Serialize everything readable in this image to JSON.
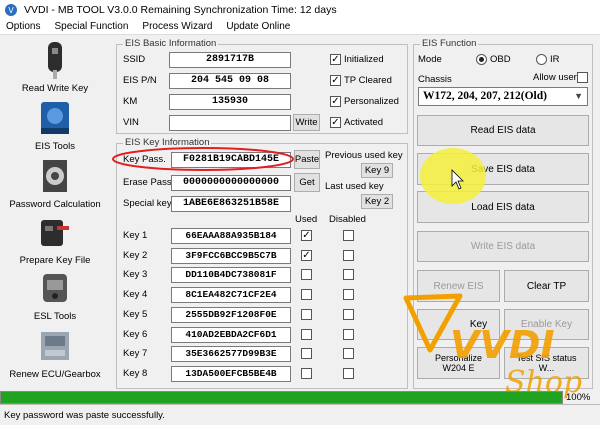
{
  "window": {
    "title": "VVDI - MB TOOL V3.0.0   Remaining Synchronization Time: 12 days"
  },
  "menu": [
    "Options",
    "Special Function",
    "Process Wizard",
    "Update Online"
  ],
  "sidebar": [
    {
      "label": "Read Write Key",
      "icon": "car-key-icon"
    },
    {
      "label": "EIS Tools",
      "icon": "eis-module-icon"
    },
    {
      "label": "Password Calculation",
      "icon": "gear-calculation-icon"
    },
    {
      "label": "Prepare Key File",
      "icon": "key-file-icon"
    },
    {
      "label": "ESL Tools",
      "icon": "esl-lock-icon"
    },
    {
      "label": "Renew ECU/Gearbox",
      "icon": "ecu-module-icon"
    }
  ],
  "eis_basic": {
    "title": "EIS Basic Information",
    "ssid_label": "SSID",
    "ssid": "2891717B",
    "pn_label": "EIS P/N",
    "pn": "204 545 09 08",
    "km_label": "KM",
    "km": "135930",
    "vin_label": "VIN",
    "vin": "",
    "write_label": "Write",
    "flags": [
      {
        "label": "Initialized",
        "checked": true
      },
      {
        "label": "TP Cleared",
        "checked": true
      },
      {
        "label": "Personalized",
        "checked": true
      },
      {
        "label": "Activated",
        "checked": true
      }
    ]
  },
  "eis_key": {
    "title": "EIS Key Information",
    "keypass_label": "Key Pass.",
    "keypass": "F0281B19CABD145E",
    "paste_label": "Paste",
    "erase_label": "Erase Pass.",
    "erase": "0000000000000000",
    "get_label": "Get",
    "special_label": "Special key",
    "special": "1ABE6E863251B58E",
    "prev_used_label": "Previous used key",
    "prev_used": "Key 9",
    "last_used_label": "Last used key",
    "last_used": "Key 2",
    "used_header": "Used",
    "disabled_header": "Disabled",
    "keys": [
      {
        "name": "Key 1",
        "code": "66EAAA88A935B184",
        "used": true,
        "disabled": false
      },
      {
        "name": "Key 2",
        "code": "3F9FCC6BCC9B5C7B",
        "used": true,
        "disabled": false
      },
      {
        "name": "Key 3",
        "code": "DD110B4DC738081F",
        "used": false,
        "disabled": false
      },
      {
        "name": "Key 4",
        "code": "8C1EA482C71CF2E4",
        "used": false,
        "disabled": false
      },
      {
        "name": "Key 5",
        "code": "2555DB92F1208F0E",
        "used": false,
        "disabled": false
      },
      {
        "name": "Key 6",
        "code": "410AD2EBDA2CF6D1",
        "used": false,
        "disabled": false
      },
      {
        "name": "Key 7",
        "code": "35E3662577D99B3E",
        "used": false,
        "disabled": false
      },
      {
        "name": "Key 8",
        "code": "13DA500EFCB5BE4B",
        "used": false,
        "disabled": false
      }
    ]
  },
  "eis_function": {
    "title": "EIS Function",
    "mode_label": "Mode",
    "mode_obd": "OBD",
    "mode_ir": "IR",
    "mode_selected": "OBD",
    "chassis_label": "Chassis",
    "allow_user_label": "Allow user",
    "chassis_value": "W172, 204, 207, 212(Old)",
    "buttons": {
      "read": "Read EIS data",
      "save": "Save EIS data",
      "load": "Load EIS data",
      "write": "Write EIS data",
      "renew": "Renew EIS",
      "clear_tp": "Clear TP",
      "disable_key": "Key",
      "enable_key": "Enable Key",
      "personalize": "Personalize W204 E",
      "test_sis": "Test SIS status W..."
    }
  },
  "watermark": {
    "line1": "VVDI",
    "line2": "Shop"
  },
  "status": {
    "message": "Key password was paste successfully.",
    "progress_pct": "100%",
    "progress": 1.0
  },
  "colors": {
    "progress": "#1fa321",
    "highlight": "#e02020",
    "cursor_spot": "#f5ef3a",
    "watermark": "#f2a000"
  }
}
